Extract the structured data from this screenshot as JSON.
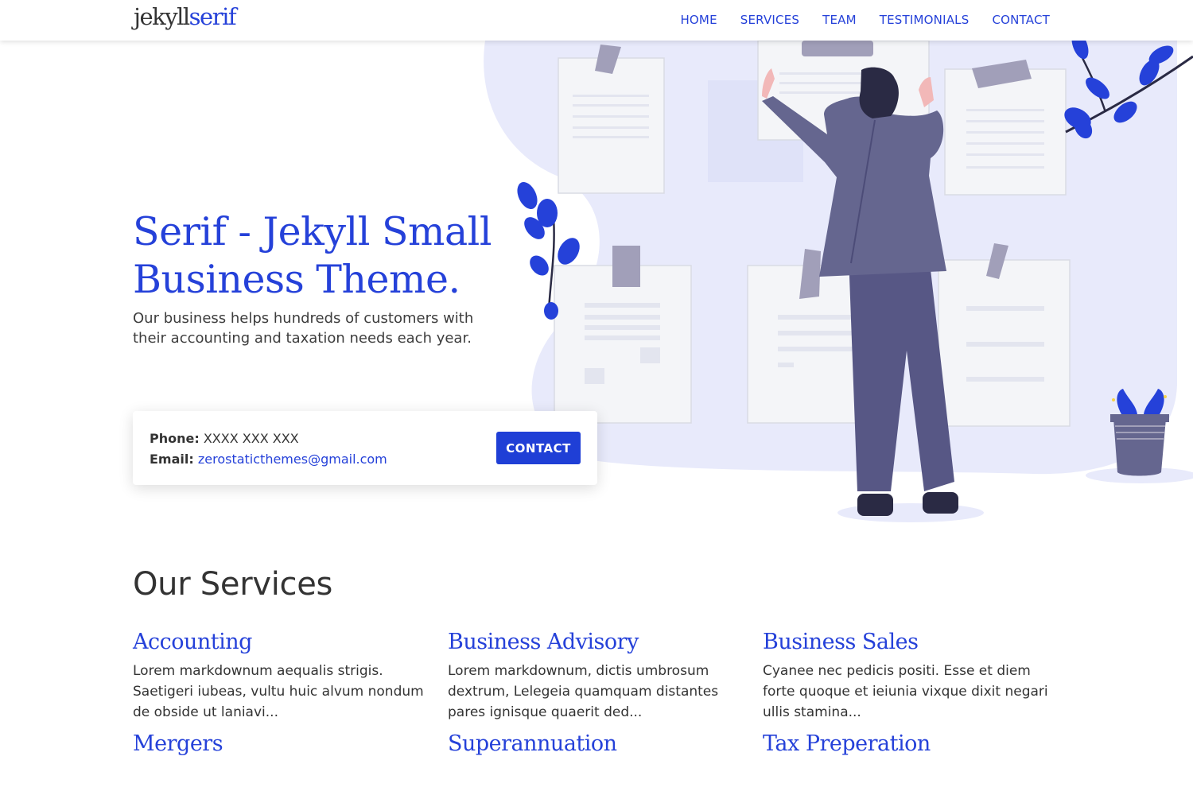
{
  "header": {
    "logo_part1": "jekyll",
    "logo_part2": "serif",
    "nav": [
      "HOME",
      "SERVICES",
      "TEAM",
      "TESTIMONIALS",
      "CONTACT"
    ]
  },
  "hero": {
    "title": "Serif - Jekyll Small Business Theme.",
    "subtitle": "Our business helps hundreds of customers with their accounting and taxation needs each year."
  },
  "contact_card": {
    "phone_label": "Phone:",
    "phone_value": "XXXX XXX XXX",
    "email_label": "Email:",
    "email_value": "zerostaticthemes@gmail.com",
    "button_label": "CONTACT"
  },
  "services": {
    "title": "Our Services",
    "items": [
      {
        "title": "Accounting",
        "desc": "Lorem markdownum aequalis strigis. Saetigeri iubeas, vultu huic alvum nondum de obside ut laniavi..."
      },
      {
        "title": "Business Advisory",
        "desc": "Lorem markdownum, dictis umbrosum dextrum, Lelegeia quamquam distantes pares ignisque quaerit ded..."
      },
      {
        "title": "Business Sales",
        "desc": "Cyanee nec pedicis positi. Esse et diem forte quoque et ieiunia vixque dixit negari ullis stamina..."
      },
      {
        "title": "Mergers",
        "desc": ""
      },
      {
        "title": "Superannuation",
        "desc": ""
      },
      {
        "title": "Tax Preperation",
        "desc": ""
      }
    ]
  },
  "colors": {
    "accent": "#2541d9",
    "blob": "#e8eafb",
    "suit": "#65668f",
    "paper": "#f4f5f8"
  },
  "illustration": {
    "icon": "person-pinning-documents-illustration"
  }
}
